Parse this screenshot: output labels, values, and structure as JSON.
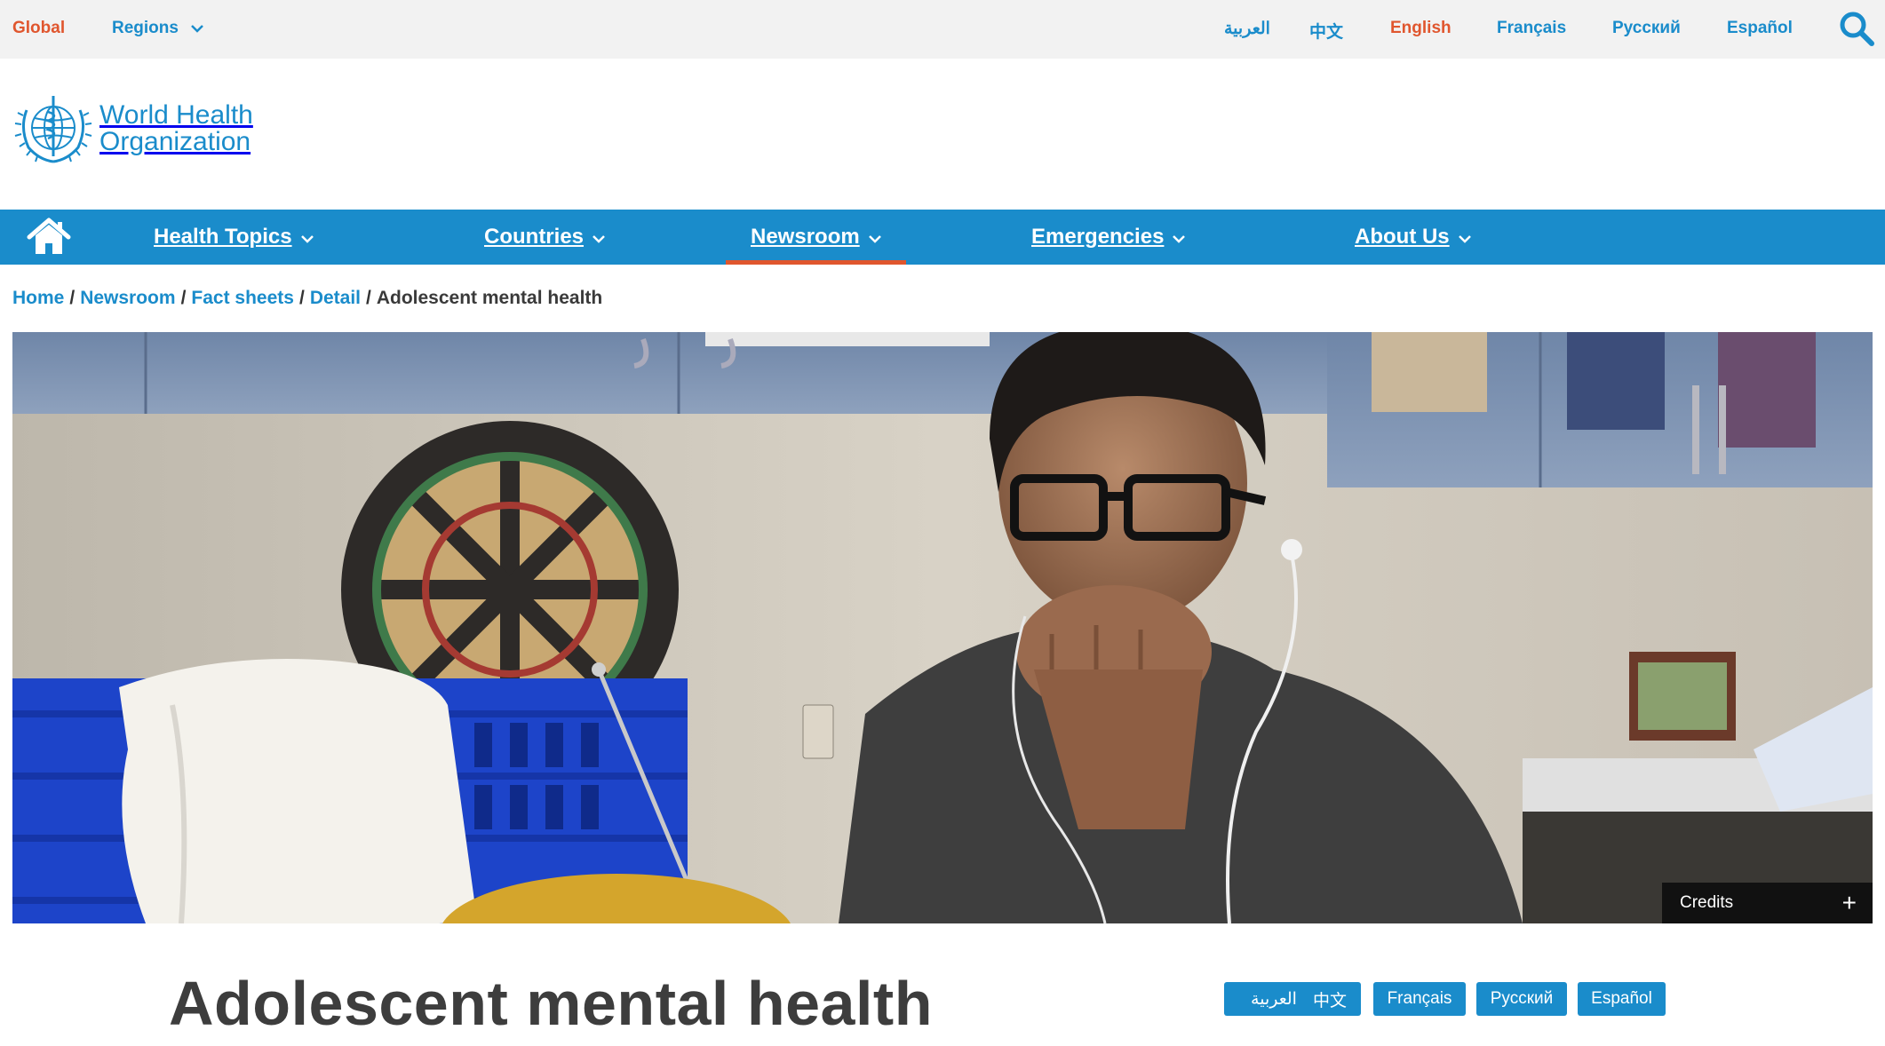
{
  "topbar": {
    "global_label": "Global",
    "regions_label": "Regions",
    "languages": [
      {
        "label": "العربية",
        "active": false
      },
      {
        "label": "中文",
        "active": false
      },
      {
        "label": "English",
        "active": true
      },
      {
        "label": "Français",
        "active": false
      },
      {
        "label": "Русский",
        "active": false
      },
      {
        "label": "Español",
        "active": false
      }
    ],
    "search_icon": "search-icon"
  },
  "logo": {
    "line1": "World Health",
    "line2": "Organization",
    "emblem_icon": "who-emblem-icon"
  },
  "nav": {
    "home_icon": "home-icon",
    "items": [
      {
        "label": "Health Topics",
        "active": false
      },
      {
        "label": "Countries",
        "active": false
      },
      {
        "label": "Newsroom",
        "active": true
      },
      {
        "label": "Emergencies",
        "active": false
      },
      {
        "label": "About Us",
        "active": false
      }
    ]
  },
  "breadcrumb": {
    "items": [
      "Home",
      "Newsroom",
      "Fact sheets",
      "Detail"
    ],
    "current": "Adolescent mental health"
  },
  "hero": {
    "credits_label": "Credits",
    "credits_toggle": "+"
  },
  "page": {
    "title": "Adolescent mental health",
    "translations": [
      "العربية",
      "中文",
      "Français",
      "Русский",
      "Español"
    ]
  },
  "colors": {
    "brand_blue": "#1a8ccb",
    "accent_orange": "#e0562e",
    "topbar_bg": "#f2f2f2",
    "title_text": "#3d3d3d"
  }
}
